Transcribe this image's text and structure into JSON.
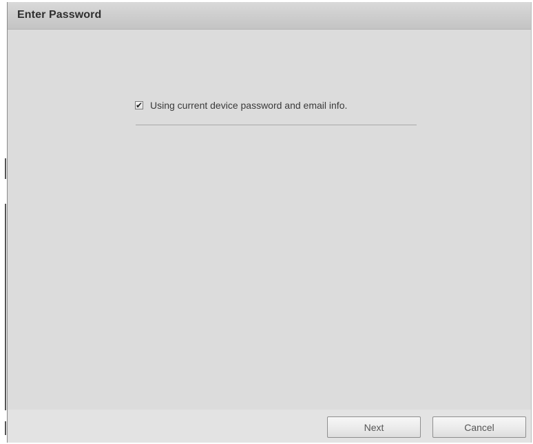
{
  "dialog": {
    "title": "Enter Password"
  },
  "option": {
    "checked": true,
    "check_glyph": "✔",
    "label": "Using current device password and email info."
  },
  "footer": {
    "next_label": "Next",
    "cancel_label": "Cancel"
  },
  "colors": {
    "dialog_background": "#dcdcdc",
    "title_bar": "#cfcfcf",
    "footer_background": "#e3e3e3",
    "text": "#3a3a3a"
  }
}
